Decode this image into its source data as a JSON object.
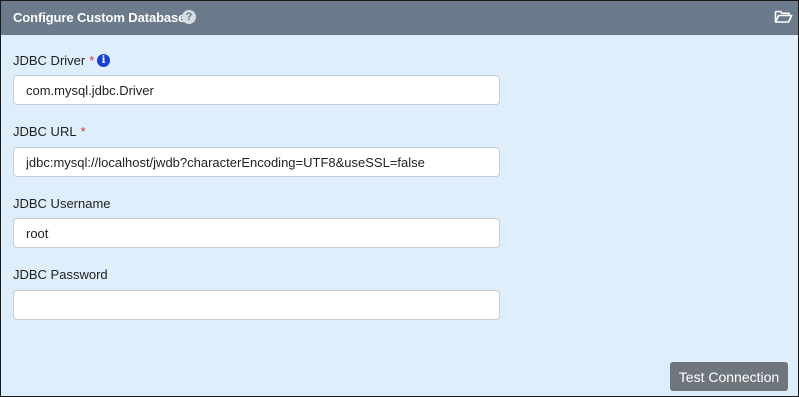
{
  "header": {
    "title": "Configure Custom Database",
    "help_icon": "question-circle-icon",
    "folder_icon": "folder-open-icon"
  },
  "form": {
    "driver": {
      "label": "JDBC Driver",
      "required_mark": "*",
      "info_icon": "info-circle-icon",
      "value": "com.mysql.jdbc.Driver"
    },
    "url": {
      "label": "JDBC URL",
      "required_mark": "*",
      "value": "jdbc:mysql://localhost/jwdb?characterEncoding=UTF8&useSSL=false"
    },
    "username": {
      "label": "JDBC Username",
      "value": "root"
    },
    "password": {
      "label": "JDBC Password",
      "value": ""
    }
  },
  "actions": {
    "test_connection_label": "Test Connection"
  },
  "colors": {
    "header_bg": "#6b7b8c",
    "panel_bg": "#dfeefb",
    "required": "#d9363e",
    "info": "#1a3fd6",
    "button_bg": "#6f757c"
  }
}
